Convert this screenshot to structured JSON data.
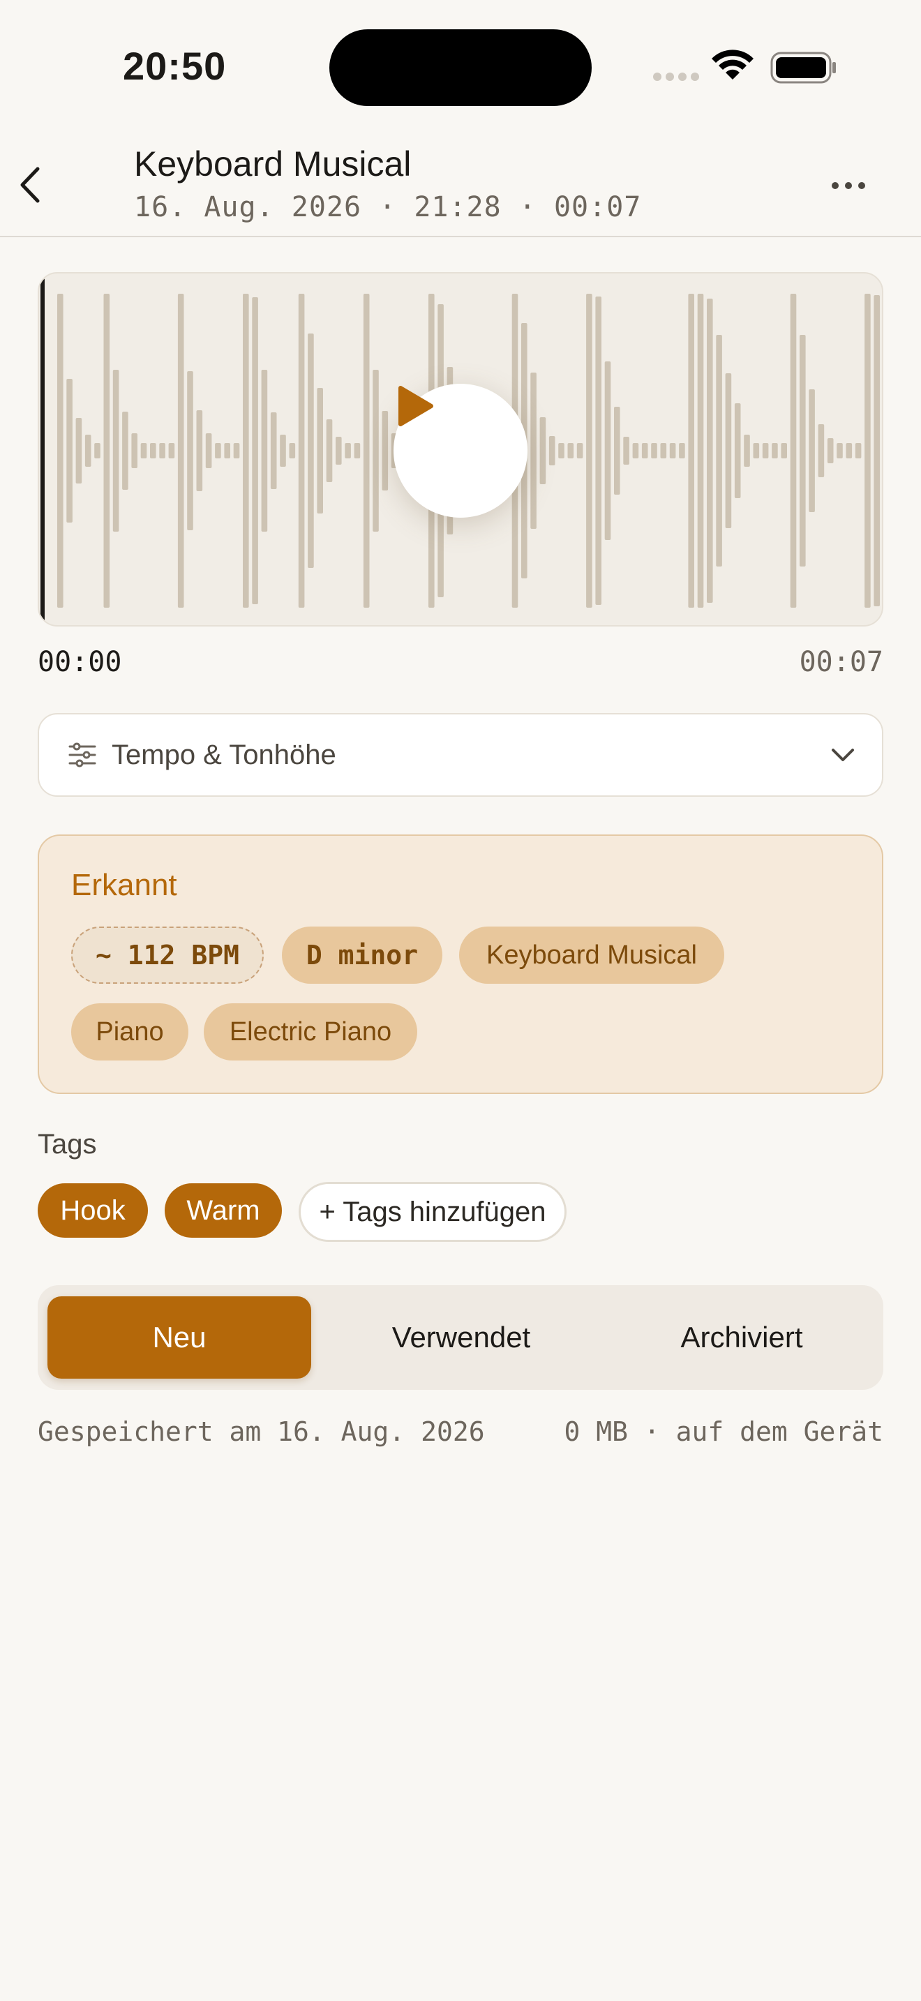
{
  "status_bar": {
    "time": "20:50"
  },
  "header": {
    "title": "Keyboard Musical",
    "subtitle": "16. Aug. 2026 · 21:28 · 00:07"
  },
  "player": {
    "current_time": "00:00",
    "total_time": "00:07",
    "progress": 0.0
  },
  "tempo_section": {
    "label": "Tempo & Tonhöhe"
  },
  "detected": {
    "heading": "Erkannt",
    "chips": [
      "~ 112 BPM",
      "D minor",
      "Keyboard Musical",
      "Piano",
      "Electric Piano"
    ]
  },
  "tags": {
    "label": "Tags",
    "items": [
      "Hook",
      "Warm"
    ],
    "add_label": "+ Tags hinzufügen"
  },
  "status_segment": {
    "options": [
      "Neu",
      "Verwendet",
      "Archiviert"
    ],
    "selected": "Neu"
  },
  "footer": {
    "saved": "Gespeichert am 16. Aug. 2026",
    "size": "0 MB · auf dem Gerät"
  },
  "colors": {
    "accent": "#b4680a",
    "background": "#f9f7f3",
    "waveform": "#cdc3b3"
  }
}
